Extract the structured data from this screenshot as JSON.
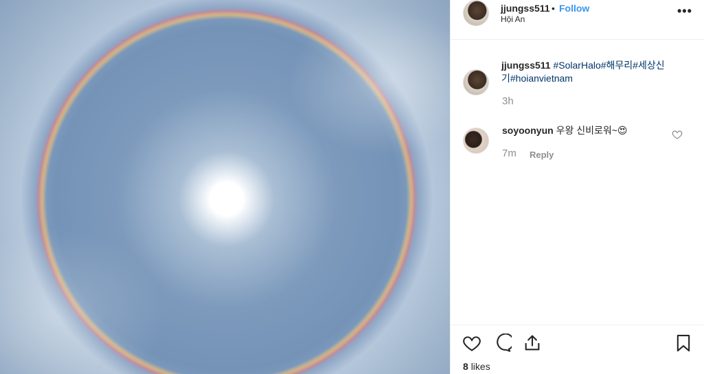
{
  "post": {
    "author": "jjungss511",
    "separator": "•",
    "follow_label": "Follow",
    "location": "Hội An",
    "more_label": "•••",
    "caption_text_prefix": "",
    "caption_tags_line1": "#SolarHalo#해무리#세상신",
    "caption_tags_line2": "기#hoianvietnam",
    "caption_time": "3h"
  },
  "comments": [
    {
      "user": "soyoonyun",
      "text": "우왕 신비로워~😍",
      "time": "7m",
      "reply_label": "Reply"
    }
  ],
  "actions": {
    "likes_count": "8",
    "likes_label": "likes"
  },
  "icons": {
    "like": "heart-outline-icon",
    "comment": "comment-bubble-icon",
    "share": "share-upload-icon",
    "save": "bookmark-icon",
    "more": "more-options-icon",
    "comment_like": "small-heart-icon"
  },
  "colors": {
    "link_blue": "#3897f0",
    "hashtag": "#003569",
    "muted": "#8e8e8e",
    "text": "#262626"
  }
}
